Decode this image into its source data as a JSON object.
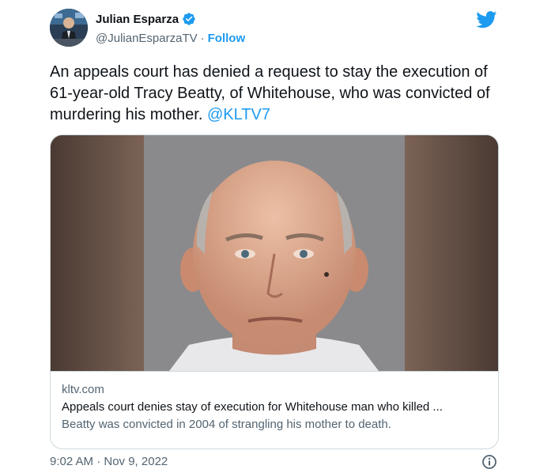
{
  "author": {
    "display_name": "Julian Esparza",
    "handle": "@JulianEsparzaTV",
    "separator": "·",
    "follow_label": "Follow"
  },
  "tweet": {
    "text_main": "An appeals court has denied a request to stay the execution of 61-year-old Tracy Beatty, of Whitehouse, who was convicted of murdering his mother. ",
    "mention": "@KLTV7"
  },
  "card": {
    "domain": "kltv.com",
    "title": "Appeals court denies stay of execution for Whitehouse man who killed ...",
    "description": "Beatty was convicted in 2004 of strangling his mother to death."
  },
  "footer": {
    "timestamp": "9:02 AM · Nov 9, 2022"
  },
  "icons": {
    "verified": "verified-badge-icon",
    "brand": "twitter-bird-icon",
    "info": "info-icon"
  },
  "colors": {
    "accent": "#1d9bf0",
    "text": "#0f1419",
    "secondary": "#536471",
    "border": "#cfd9de"
  }
}
